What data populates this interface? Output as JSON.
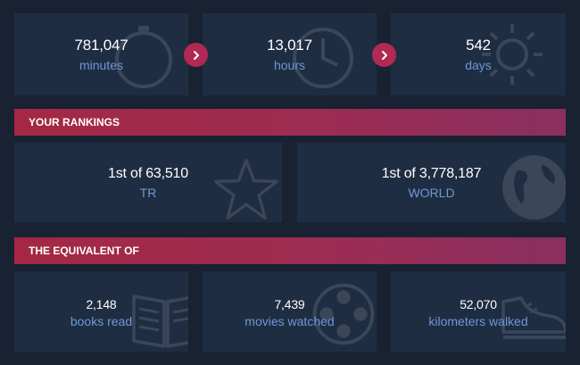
{
  "time_stats": [
    {
      "value": "781,047",
      "label": "minutes"
    },
    {
      "value": "13,017",
      "label": "hours"
    },
    {
      "value": "542",
      "label": "days"
    }
  ],
  "rankings": {
    "title": "YOUR RANKINGS",
    "items": [
      {
        "value": "1st of 63,510",
        "label": "TR"
      },
      {
        "value": "1st of 3,778,187",
        "label": "WORLD"
      }
    ]
  },
  "equivalent": {
    "title": "THE EQUIVALENT OF",
    "items": [
      {
        "value": "2,148",
        "label": "books read"
      },
      {
        "value": "7,439",
        "label": "movies watched"
      },
      {
        "value": "52,070",
        "label": "kilometers walked"
      }
    ]
  },
  "colors": {
    "background": "#182232",
    "card": "#1f2d42",
    "accent": "#b02a54",
    "label": "#6f97d6"
  }
}
